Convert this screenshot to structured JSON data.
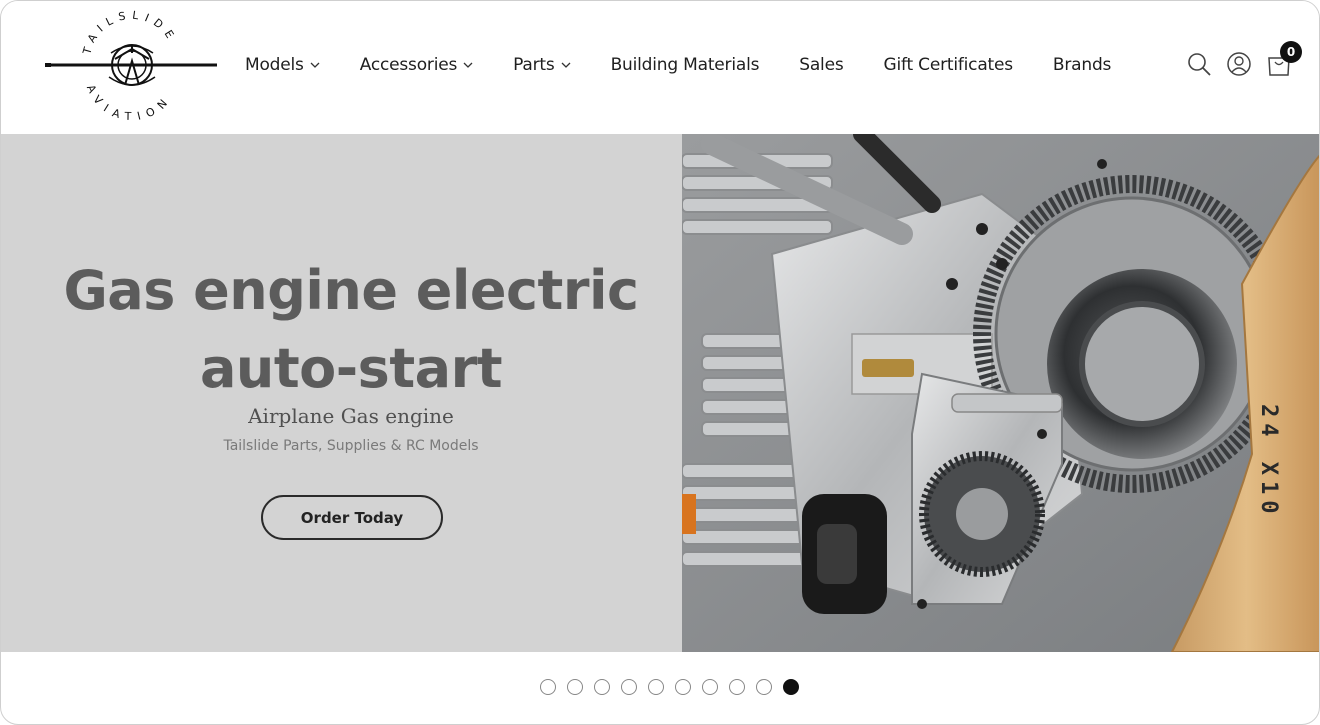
{
  "brand": {
    "name_top": "TAILSLIDE",
    "name_bottom": "AVIATION"
  },
  "nav": {
    "items": [
      {
        "label": "Models",
        "has_dropdown": true
      },
      {
        "label": "Accessories",
        "has_dropdown": true
      },
      {
        "label": "Parts",
        "has_dropdown": true
      },
      {
        "label": "Building Materials",
        "has_dropdown": false
      },
      {
        "label": "Sales",
        "has_dropdown": false
      },
      {
        "label": "Gift Certificates",
        "has_dropdown": false
      },
      {
        "label": "Brands",
        "has_dropdown": false
      }
    ]
  },
  "tools": {
    "search_icon": "search-icon",
    "account_icon": "user-icon",
    "cart_icon": "cart-icon",
    "cart_count": "0"
  },
  "hero": {
    "title_line1": "Gas engine electric",
    "title_line2": "auto-start",
    "subtitle": "Airplane Gas engine",
    "tagline": "Tailslide Parts, Supplies & RC Models",
    "cta_label": "Order Today",
    "image_text": "24 X10"
  },
  "slider": {
    "total_slides": 10,
    "active_index": 9
  },
  "colors": {
    "hero_left_bg": "#d3d3d3",
    "title": "#5c5c5c",
    "accent": "#111111"
  }
}
